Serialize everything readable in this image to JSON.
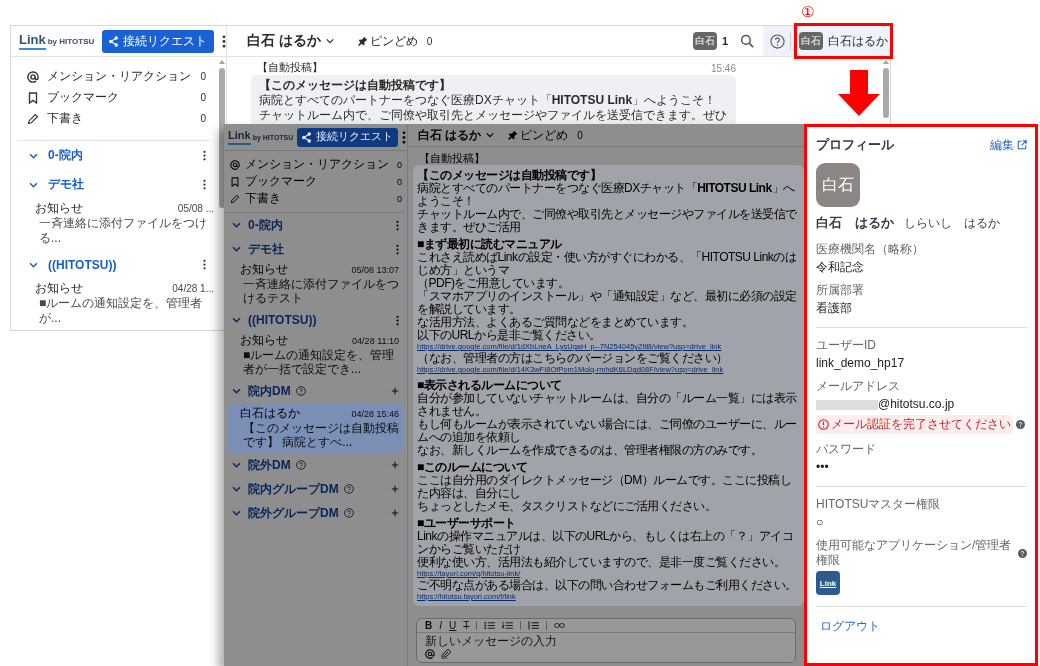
{
  "annotation": {
    "step": "①"
  },
  "screens": [
    {
      "dimmed": false,
      "scrollbars": true,
      "brand": {
        "wordmark": "Link",
        "byline": "by HITOTSU"
      },
      "connect_button": "接続リクエスト",
      "shortcuts": [
        {
          "kind": "mention",
          "label": "メンション・リアクション",
          "count": "0"
        },
        {
          "kind": "bookmark",
          "label": "ブックマーク",
          "count": "0"
        },
        {
          "kind": "draft",
          "label": "下書き",
          "count": "0"
        }
      ],
      "groups": [
        {
          "kind": "channel",
          "name": "0-院内",
          "expanded": true
        },
        {
          "kind": "channel",
          "name": "デモ社",
          "expanded": true,
          "rooms": [
            {
              "name": "お知らせ",
              "time": "05/08 ...",
              "preview": "一斉連絡に添付ファイルをつける...",
              "selected": false
            }
          ]
        },
        {
          "kind": "channel",
          "name": "((HITOTSU))",
          "expanded": true,
          "rooms": [
            {
              "name": "お知らせ",
              "time": "04/28 1...",
              "preview": "■ルームの通知設定を、管理者が...",
              "selected": false
            }
          ]
        }
      ],
      "chat": {
        "title": "白石 はるか",
        "pin_label": "ピンどめ",
        "pin_count": "0",
        "toolbar": {
          "member_avatar": "白石",
          "member_count": "1",
          "user_avatar": "白石",
          "user_name": "白石はるか"
        },
        "message": {
          "tag": "【自動投稿】",
          "time": "15:46",
          "paragraphs": [
            [
              {
                "kind": "heading",
                "text": "【このメッセージは自動投稿です】"
              },
              {
                "kind": "text",
                "text": "病院とすべてのパートナーをつなぐ医療DXチャット「**HITOTSU Link**」へようこそ！"
              },
              {
                "kind": "text",
                "text": "チャットルーム内で、ご同僚や取引先とメッセージやファイルを送受信できます。ぜひ"
              }
            ]
          ]
        }
      }
    },
    {
      "dimmed": true,
      "brand": {
        "wordmark": "Link",
        "byline": "by HITOTSU"
      },
      "connect_button": "接続リクエスト",
      "shortcuts": [
        {
          "kind": "mention",
          "label": "メンション・リアクション",
          "count": "0"
        },
        {
          "kind": "bookmark",
          "label": "ブックマーク",
          "count": "0"
        },
        {
          "kind": "draft",
          "label": "下書き",
          "count": "0"
        }
      ],
      "groups": [
        {
          "kind": "channel",
          "name": "0-院内",
          "expanded": true
        },
        {
          "kind": "channel",
          "name": "デモ社",
          "expanded": true,
          "rooms": [
            {
              "name": "お知らせ",
              "time": "05/08 13:07",
              "preview": "一斉連絡に添付ファイルをつけるテスト",
              "selected": false
            }
          ]
        },
        {
          "kind": "channel",
          "name": "((HITOTSU))",
          "expanded": true,
          "rooms": [
            {
              "name": "お知らせ",
              "time": "04/28 11:10",
              "preview": "■ルームの通知設定を、管理者が一括で設定でき...",
              "selected": false
            }
          ]
        },
        {
          "kind": "dm",
          "name": "院内DM",
          "expanded": true,
          "rooms": [
            {
              "name": "白石はるか",
              "time": "04/28 15:46",
              "preview": "【このメッセージは自動投稿です】 病院とすべ...",
              "selected": true
            }
          ]
        },
        {
          "kind": "dm",
          "name": "院外DM",
          "expanded": true
        },
        {
          "kind": "dm",
          "name": "院内グループDM",
          "expanded": true
        },
        {
          "kind": "dm",
          "name": "院外グループDM",
          "expanded": true
        }
      ],
      "chat": {
        "title": "白石 はるか",
        "pin_label": "ピンどめ",
        "pin_count": "0",
        "message": {
          "tag": "【自動投稿】",
          "paragraphs": [
            [
              {
                "kind": "heading",
                "text": "【このメッセージは自動投稿です】"
              },
              {
                "kind": "text",
                "text": "病院とすべてのパートナーをつなぐ医療DXチャット「**HITOTSU Link**」へようこそ！"
              },
              {
                "kind": "text",
                "text": "チャットルーム内で、ご同僚や取引先とメッセージやファイルを送受信できます。ぜひご活用"
              }
            ],
            [
              {
                "kind": "heading",
                "text": "■まず最初に読むマニュアル"
              },
              {
                "kind": "text",
                "text": "これさえ読めばLinkの設定・使い方がすぐにわかる、「HITOTSU Linkのはじめ方」というマ"
              },
              {
                "kind": "text",
                "text": "（PDF)をご用意しています。"
              },
              {
                "kind": "text",
                "text": "「スマホアプリのインストール」や「通知設定」など、最初に必須の設定を解説しています。"
              },
              {
                "kind": "text",
                "text": "な活用方法、よくあるご質問などをまとめています。"
              },
              {
                "kind": "text",
                "text": "以下のURLから是非ご覧ください。"
              },
              {
                "kind": "link",
                "text": "https://drive.google.com/file/d/1dXbLneA_LysUgaH_p--7N254045yZttB/view?usp=drive_link"
              },
              {
                "kind": "text",
                "text": "（なお、管理者の方はこちらのバージョンをご覧ください）"
              },
              {
                "kind": "link",
                "text": "https://drive.google.com/file/d/14K3wFI8OfPom1Molq-rmhdK6LDgd08F/view?usp=drive_link"
              }
            ],
            [
              {
                "kind": "heading",
                "text": "■表示されるルームについて"
              },
              {
                "kind": "text",
                "text": "自分が参加していないチャットルームは、自分の「ルーム一覧」には表示されません。"
              },
              {
                "kind": "text",
                "text": "もし何もルームが表示されていない場合には、ご同僚のユーザーに、ルームへの追加を依頼し"
              },
              {
                "kind": "text",
                "text": "なお、新しくルームを作成できるのは、管理者権限の方のみです。"
              }
            ],
            [
              {
                "kind": "heading",
                "text": "■このルームについて"
              },
              {
                "kind": "text",
                "text": "ここは自分用のダイレクトメッセージ（DM）ルームです。ここに投稿した内容は、自分にし"
              },
              {
                "kind": "text",
                "text": "ちょっとしたメモ、タスクリストなどにご活用ください。"
              }
            ],
            [
              {
                "kind": "heading",
                "text": "■ユーザーサポート"
              },
              {
                "kind": "text",
                "text": "Linkの操作マニュアルは、以下のURLから、もしくは右上の「？」アイコンからご覧いただけ"
              },
              {
                "kind": "text",
                "text": "便利な使い方、活用法も紹介していますので、是非一度ご覧ください。"
              },
              {
                "kind": "link",
                "text": "https://tayori.com/q/hitotsu-link/"
              },
              {
                "kind": "text",
                "text": "ご不明な点がある場合は、以下の問い合わせフォームもご利用ください。"
              },
              {
                "kind": "link",
                "text": "https://hitotsu.tayori.com/f/link"
              }
            ]
          ]
        }
      },
      "composer": {
        "format_tools": [
          {
            "kind": "bold",
            "glyph": "B"
          },
          {
            "kind": "italic",
            "glyph": "I"
          },
          {
            "kind": "underline",
            "glyph": "U"
          },
          {
            "kind": "strike",
            "glyph": "T"
          }
        ],
        "placeholder": "新しいメッセージの入力"
      },
      "profile": {
        "title": "プロフィール",
        "edit_link": "編集",
        "avatar": "白石",
        "name": "白石　はるか",
        "reading": "しらいし　はるか",
        "sections": [
          [
            {
              "kind": "text",
              "label": "医療機関名（略称）",
              "value": "令和記念"
            },
            {
              "kind": "text",
              "label": "所属部署",
              "value": "看護部"
            }
          ],
          [
            {
              "kind": "text",
              "label": "ユーザーID",
              "value": "link_demo_hp17"
            },
            {
              "kind": "email",
              "label": "メールアドレス",
              "redacted": true,
              "value": "@hitotsu.co.jp",
              "warning": "メール認証を完了させてください",
              "help": true
            },
            {
              "kind": "text",
              "label": "パスワード",
              "value": "•••"
            }
          ],
          [
            {
              "kind": "text",
              "label": "HITOTSUマスター権限",
              "value": "○"
            },
            {
              "kind": "apps",
              "label": "使用可能なアプリケーション/管理者権限",
              "help": true,
              "apps": [
                "Link"
              ]
            }
          ]
        ],
        "logout": "ログアウト"
      }
    }
  ]
}
